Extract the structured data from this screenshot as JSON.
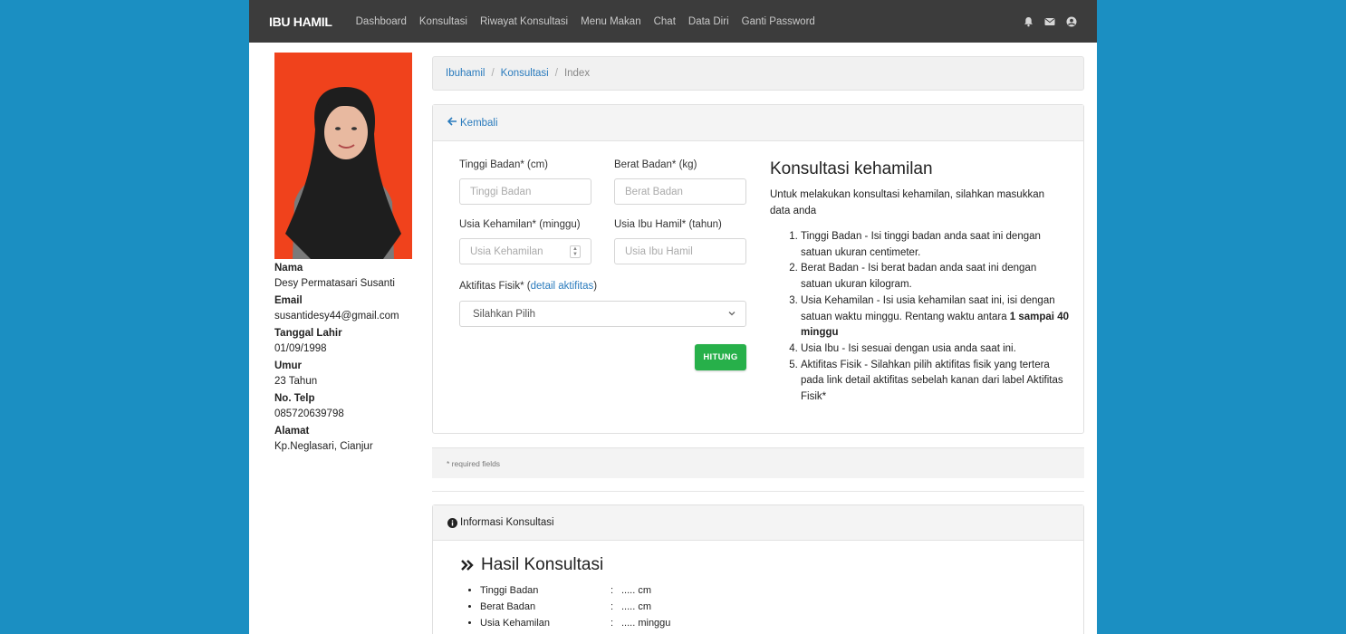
{
  "navbar": {
    "brand": "IBU HAMIL",
    "links": [
      "Dashboard",
      "Konsultasi",
      "Riwayat Konsultasi",
      "Menu Makan",
      "Chat",
      "Data Diri",
      "Ganti Password"
    ],
    "icons": [
      "bell-icon",
      "envelope-icon",
      "user-circle-icon"
    ]
  },
  "profile": {
    "fields": [
      {
        "label": "Nama",
        "value": "Desy Permatasari Susanti"
      },
      {
        "label": "Email",
        "value": "susantidesy44@gmail.com"
      },
      {
        "label": "Tanggal Lahir",
        "value": "01/09/1998"
      },
      {
        "label": "Umur",
        "value": "23 Tahun"
      },
      {
        "label": "No. Telp",
        "value": "085720639798"
      },
      {
        "label": "Alamat",
        "value": "Kp.Neglasari, Cianjur"
      }
    ]
  },
  "breadcrumb": [
    "Ibuhamil",
    "Konsultasi",
    "Index"
  ],
  "form": {
    "back_label": "Kembali",
    "tinggi_label": "Tinggi Badan* (cm)",
    "tinggi_placeholder": "Tinggi Badan",
    "berat_label": "Berat Badan* (kg)",
    "berat_placeholder": "Berat Badan",
    "usia_hamil_label": "Usia Kehamilan* (minggu)",
    "usia_hamil_placeholder": "Usia Kehamilan",
    "usia_ibu_label": "Usia Ibu Hamil* (tahun)",
    "usia_ibu_placeholder": "Usia Ibu Hamil",
    "aktifitas_label": "Aktifitas Fisik* (",
    "aktifitas_link": "detail aktifitas",
    "aktifitas_close": ")",
    "select_value": "Silahkan Pilih",
    "submit_label": "HITUNG",
    "required_note": "* required fields"
  },
  "help": {
    "title": "Konsultasi kehamilan",
    "intro": "Untuk melakukan konsultasi kehamilan, silahkan masukkan data anda",
    "items": [
      "Tinggi Badan - Isi tinggi badan anda saat ini dengan satuan ukuran centimeter.",
      "Berat Badan - Isi berat badan anda saat ini dengan satuan ukuran kilogram.",
      "Usia Kehamilan - Isi usia kehamilan saat ini, isi dengan satuan waktu minggu. Rentang waktu antara ",
      "Usia Ibu - Isi sesuai dengan usia anda saat ini.",
      "Aktifitas Fisik - Silahkan pilih aktifitas fisik yang tertera pada link detail aktifitas sebelah kanan dari label Aktifitas Fisik*"
    ],
    "item3_bold": "1 sampai 40 minggu"
  },
  "info": {
    "header": "Informasi Konsultasi",
    "hasil_title": "Hasil Konsultasi",
    "rows": [
      {
        "label": "Tinggi Badan",
        "sep": ":",
        "value": "..... cm"
      },
      {
        "label": "Berat Badan",
        "sep": ":",
        "value": "..... cm"
      },
      {
        "label": "Usia Kehamilan",
        "sep": ":",
        "value": "..... minggu"
      }
    ]
  }
}
